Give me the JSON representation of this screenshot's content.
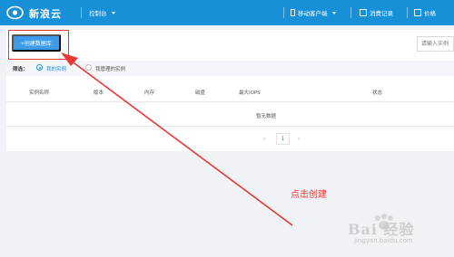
{
  "header": {
    "brand": "新浪云",
    "console_label": "控制台",
    "mobile_client_label": "移动客户端",
    "spend_records_label": "消费记录",
    "pricing_label": "价格"
  },
  "toolbar": {
    "create_button_label": "+创建数据库",
    "search_placeholder": "请输入实例"
  },
  "filter": {
    "label": "筛选：",
    "options": [
      "我的实例",
      "我管理的实例"
    ],
    "selected": "我的实例"
  },
  "table": {
    "columns": [
      "实例名称",
      "版本",
      "内存",
      "磁盘",
      "最大IOPS",
      "状态"
    ],
    "empty_text": "暂无数据"
  },
  "pagination": {
    "prev": "‹",
    "current_page": "1",
    "next": "›"
  },
  "annotation": {
    "note": "点击创建",
    "color": "#e53935"
  },
  "watermark": {
    "text": "Bai 经验",
    "url": "jingyan.baidu.com"
  },
  "colors": {
    "header_bg": "#1790d8",
    "primary_button": "#3d9be9"
  }
}
